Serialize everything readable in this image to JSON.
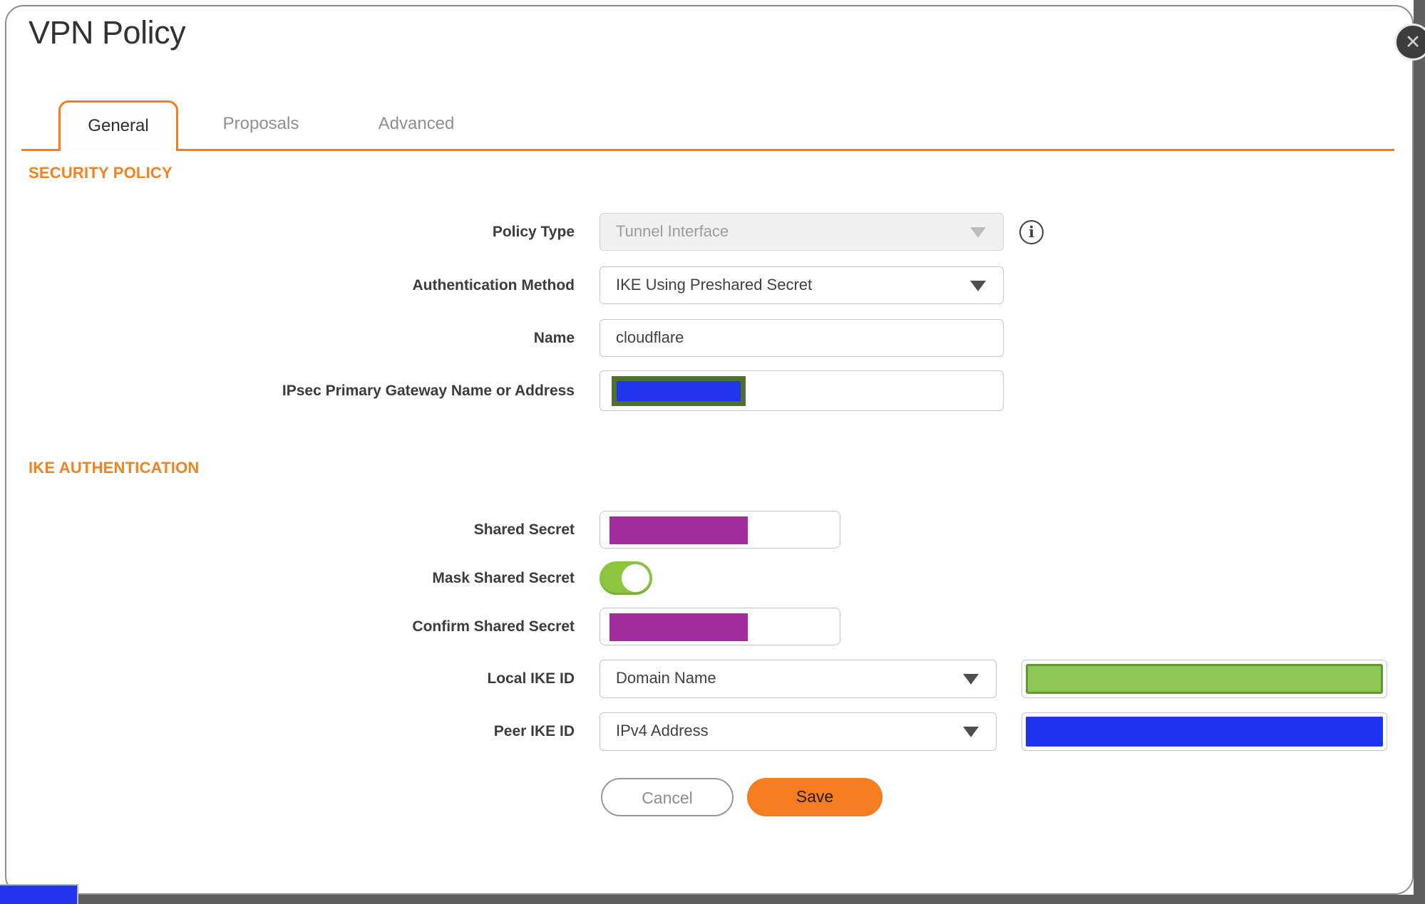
{
  "dialog": {
    "title": "VPN Policy"
  },
  "tabs": [
    {
      "label": "General",
      "active": true
    },
    {
      "label": "Proposals",
      "active": false
    },
    {
      "label": "Advanced",
      "active": false
    }
  ],
  "sections": {
    "security_policy": "SECURITY POLICY",
    "ike_authentication": "IKE AUTHENTICATION"
  },
  "fields": {
    "policy_type": {
      "label": "Policy Type",
      "value": "Tunnel Interface",
      "disabled": true
    },
    "authentication_method": {
      "label": "Authentication Method",
      "value": "IKE Using Preshared Secret"
    },
    "name": {
      "label": "Name",
      "value": "cloudflare"
    },
    "ipsec_primary_gateway": {
      "label": "IPsec Primary Gateway Name or Address",
      "value": ""
    },
    "shared_secret": {
      "label": "Shared Secret",
      "value": ""
    },
    "mask_shared_secret": {
      "label": "Mask Shared Secret",
      "state": "on"
    },
    "confirm_shared_secret": {
      "label": "Confirm Shared Secret",
      "value": ""
    },
    "local_ike_id": {
      "label": "Local IKE ID",
      "value": "Domain Name"
    },
    "peer_ike_id": {
      "label": "Peer IKE ID",
      "value": "IPv4 Address"
    }
  },
  "buttons": {
    "cancel": {
      "label": "Cancel"
    },
    "save": {
      "label": "Save"
    }
  },
  "icons": {
    "close": "✕",
    "info": "i"
  },
  "colors": {
    "accent_orange": "#F57C1F",
    "heading_orange": "#F5821F",
    "toggle_green": "#8CC63F",
    "redaction_purple": "#A02C9E",
    "redaction_blue": "#2135EE",
    "redaction_green_fill": "#8DC653",
    "redaction_green_border": "#5F9B31",
    "redaction_olive_border": "#507129",
    "backdrop_gray": "#5E5E5E"
  }
}
